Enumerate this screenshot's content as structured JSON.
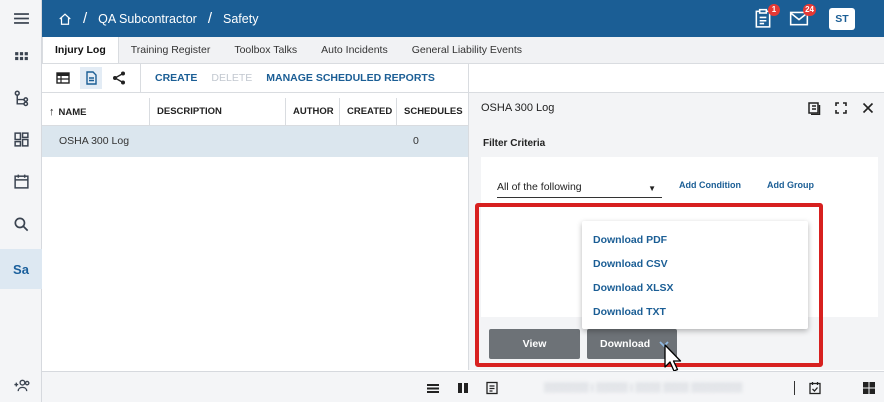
{
  "breadcrumb": {
    "project": "QA Subcontractor",
    "section": "Safety"
  },
  "header": {
    "notifications": [
      {
        "icon": "clipboard-icon",
        "count": "1"
      },
      {
        "icon": "mail-icon",
        "count": "24"
      }
    ],
    "user_initials": "ST"
  },
  "rail": {
    "items": [
      {
        "icon": "grid-apps-icon"
      },
      {
        "icon": "hierarchy-icon"
      },
      {
        "icon": "dashboard-icon"
      },
      {
        "icon": "calendar-icon"
      },
      {
        "icon": "search-icon"
      },
      {
        "icon": "safety-module",
        "label": "Sa"
      },
      {
        "icon": "add-users-icon"
      }
    ]
  },
  "tabs": [
    "Injury Log",
    "Training Register",
    "Toolbox Talks",
    "Auto Incidents",
    "General Liability Events"
  ],
  "toolbar": {
    "create": "CREATE",
    "delete": "DELETE",
    "manage": "MANAGE SCHEDULED REPORTS"
  },
  "grid": {
    "columns": [
      "NAME",
      "DESCRIPTION",
      "AUTHOR",
      "CREATED",
      "SCHEDULES"
    ],
    "rows": [
      {
        "name": "OSHA 300 Log",
        "description": "",
        "author": "",
        "created": "",
        "schedules": "0"
      }
    ]
  },
  "panel": {
    "title": "OSHA 300 Log",
    "filter_label": "Filter Criteria",
    "match_select": "All of the following",
    "add_condition": "Add Condition",
    "add_group": "Add Group"
  },
  "buttons": {
    "view": "View",
    "download": "Download"
  },
  "download_menu": [
    "Download PDF",
    "Download CSV",
    "Download XLSX",
    "Download TXT"
  ],
  "colors": {
    "brand": "#1b5e95",
    "highlight": "#d7201f",
    "button": "#6d7277",
    "selected_row": "#dbe6ee"
  }
}
